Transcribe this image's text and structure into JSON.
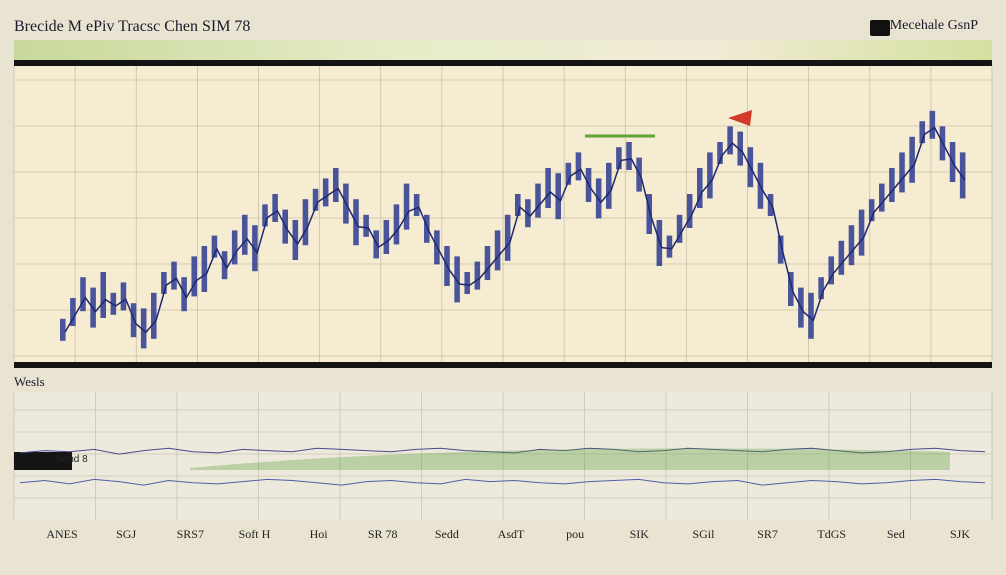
{
  "header": {
    "title": "Brecide M ePiv Tracsc Chen SIM 78",
    "brand": "Mecehale GsnP"
  },
  "lower_panel": {
    "label": "Wesls",
    "badge": "Sehd 8"
  },
  "colors": {
    "bull": "#2c3a92",
    "trend": "#1e2870",
    "panel_bg": "#f6ecd2",
    "green": "#5ea23c",
    "red": "#d23a2a",
    "lower_bg": "#ede9dc"
  },
  "chart_data": [
    {
      "type": "bar",
      "title": "",
      "xlabel": "",
      "ylabel": "",
      "ylim": [
        0,
        100
      ],
      "grid": true,
      "values": [
        12,
        20,
        28,
        24,
        30,
        22,
        26,
        18,
        16,
        22,
        30,
        34,
        28,
        36,
        40,
        44,
        38,
        46,
        52,
        48,
        56,
        60,
        54,
        50,
        58,
        62,
        66,
        70,
        64,
        58,
        52,
        46,
        50,
        56,
        64,
        60,
        52,
        46,
        40,
        36,
        30,
        34,
        40,
        46,
        52,
        60,
        58,
        64,
        70,
        68,
        72,
        76,
        70,
        66,
        72,
        78,
        80,
        74,
        60,
        50,
        44,
        52,
        60,
        70,
        76,
        80,
        86,
        84,
        78,
        72,
        60,
        44,
        30,
        24,
        22,
        28,
        36,
        42,
        48,
        54,
        58,
        64,
        70,
        76,
        82,
        88,
        92,
        86,
        80,
        76
      ]
    },
    {
      "type": "line",
      "series": [
        {
          "values": [
            54,
            56,
            55,
            57,
            53,
            56,
            58,
            55,
            54,
            57,
            56,
            55,
            58,
            57,
            56,
            55,
            57,
            58,
            56,
            55,
            54,
            57,
            56,
            58,
            57,
            55,
            56,
            58,
            57,
            56,
            55,
            57,
            58,
            56,
            54,
            55,
            57,
            58,
            56,
            55
          ]
        },
        {
          "values": [
            28,
            30,
            27,
            31,
            29,
            26,
            30,
            28,
            27,
            29,
            31,
            30,
            28,
            26,
            29,
            30,
            28,
            27,
            31,
            29,
            30,
            28,
            27,
            29,
            30,
            31,
            28,
            27,
            29,
            30,
            26,
            28,
            30,
            29,
            27,
            28,
            30,
            31,
            29,
            28
          ]
        }
      ]
    }
  ],
  "x_axis": {
    "ticks": [
      "ANES",
      "SGJ",
      "SRS7",
      "Soft H",
      "Hoi",
      "SR 78",
      "Sedd",
      "AsdT",
      "pou",
      "SIK",
      "SGil",
      "SR7",
      "TdGS",
      "Sed",
      "SJK"
    ]
  }
}
